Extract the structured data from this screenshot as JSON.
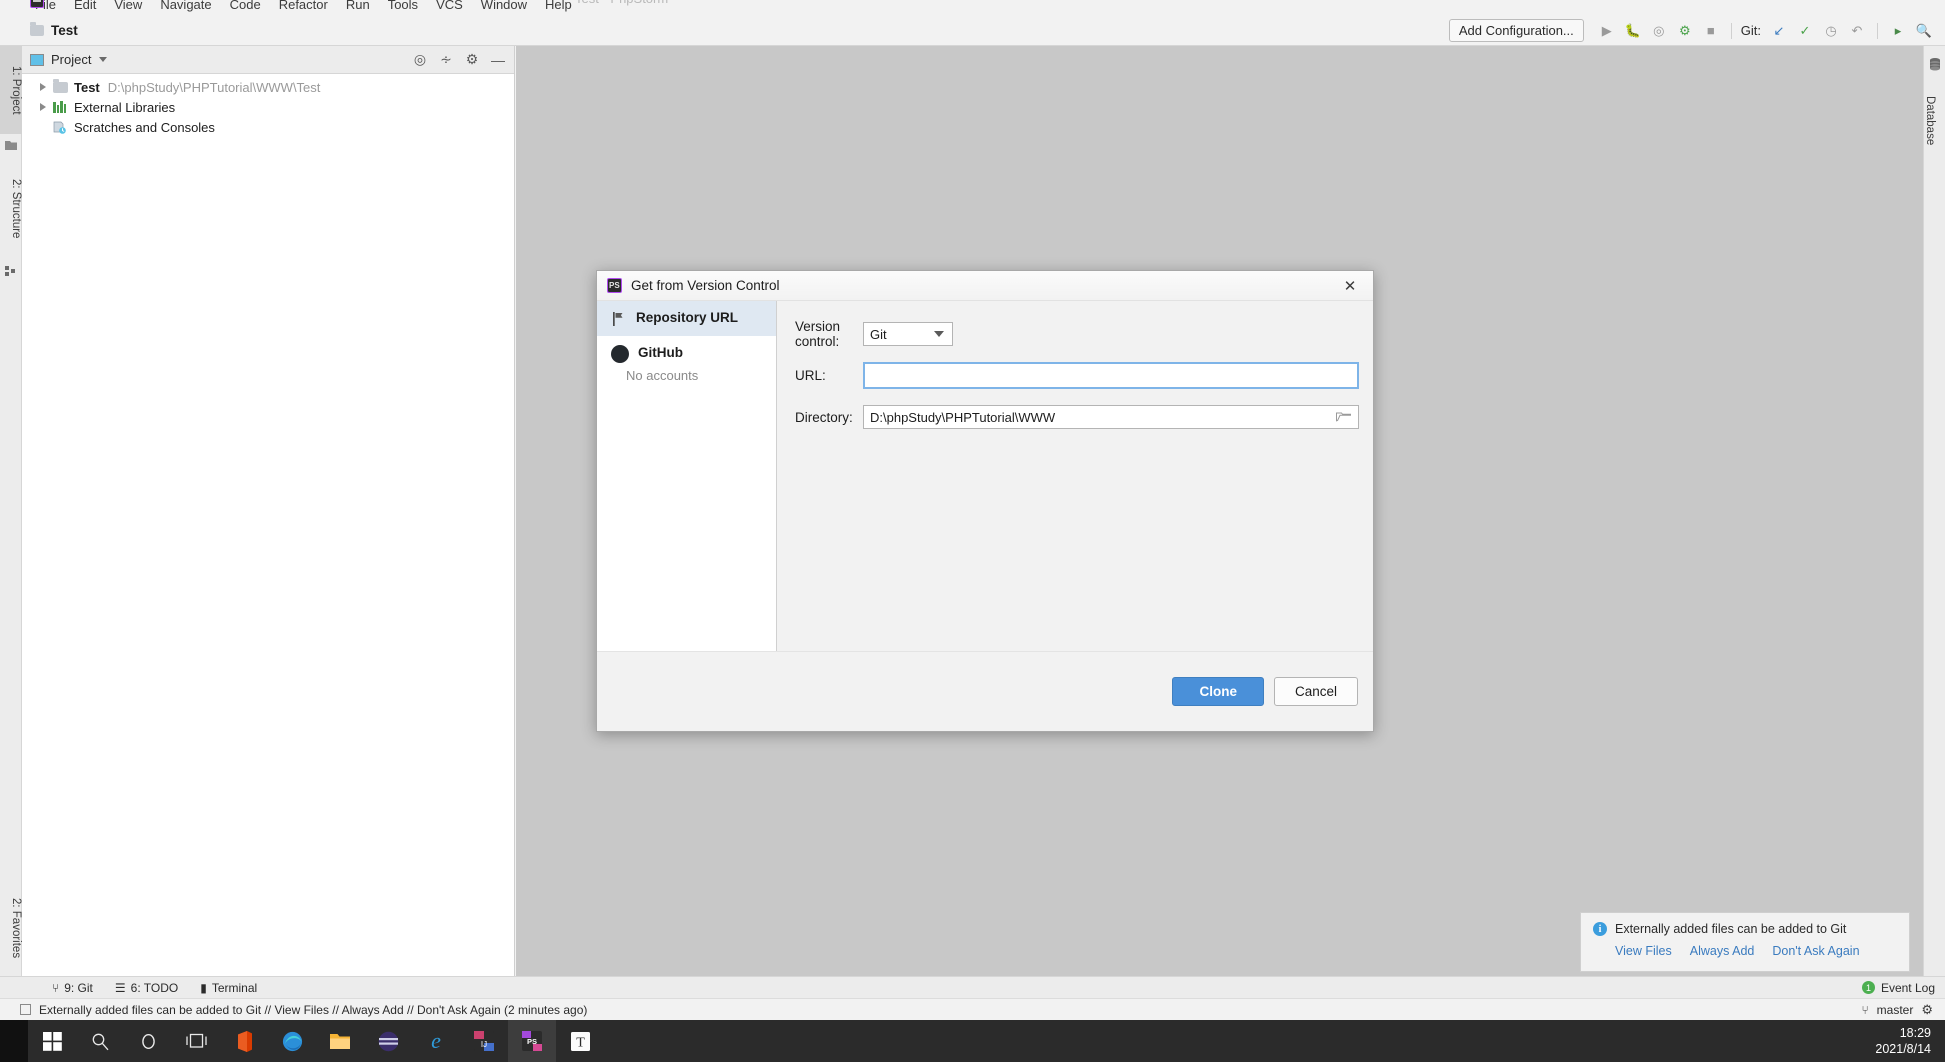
{
  "window": {
    "title": "Test - PhpStorm",
    "menu": [
      "File",
      "Edit",
      "View",
      "Navigate",
      "Code",
      "Refactor",
      "Run",
      "Tools",
      "VCS",
      "Window",
      "Help"
    ],
    "controls": [
      "minimize-icon",
      "maximize-icon",
      "close-icon"
    ]
  },
  "toolbar": {
    "breadcrumb": "Test",
    "add_configuration": "Add Configuration...",
    "git_label": "Git:",
    "icons": [
      "run-icon",
      "debug-icon",
      "run-coverage-icon",
      "profile-icon",
      "stop-icon",
      "update-project-icon",
      "commit-icon",
      "history-icon",
      "rollback-icon",
      "search-everywhere-icon",
      "find-icon"
    ]
  },
  "left_strip": {
    "tabs": [
      {
        "label": "1: Project",
        "icon": "project-icon",
        "selected": true
      },
      {
        "label": "2: Structure",
        "icon": "structure-icon",
        "selected": false
      },
      {
        "label": "2: Favorites",
        "icon": "star-icon",
        "selected": false
      }
    ]
  },
  "right_strip": {
    "tabs": [
      {
        "label": "Database",
        "icon": "database-icon"
      }
    ]
  },
  "project_panel": {
    "title": "Project",
    "actions": [
      "locate-icon",
      "collapse-all-icon",
      "settings-gear-icon",
      "hide-icon"
    ],
    "tree": [
      {
        "label": "Test",
        "path": "D:\\phpStudy\\PHPTutorial\\WWW\\Test",
        "icon": "folder-icon",
        "expandable": true,
        "bold": true
      },
      {
        "label": "External Libraries",
        "path": "",
        "icon": "library-icon",
        "expandable": true,
        "bold": false
      },
      {
        "label": "Scratches and Consoles",
        "path": "",
        "icon": "scratches-icon",
        "expandable": false,
        "bold": false
      }
    ]
  },
  "dialog": {
    "title": "Get from Version Control",
    "icon": "phpstorm-icon",
    "close_icon": "close-icon",
    "sidebar": [
      {
        "label": "Repository URL",
        "sub": "",
        "icon": "repository-url-icon",
        "active": true
      },
      {
        "label": "GitHub",
        "sub": "No accounts",
        "icon": "github-icon",
        "active": false
      }
    ],
    "fields": {
      "version_control_label": "Version control:",
      "version_control_value": "Git",
      "version_control_options": [
        "Git"
      ],
      "url_label": "URL:",
      "url_value": "",
      "url_placeholder": "",
      "directory_label": "Directory:",
      "directory_value": "D:\\phpStudy\\PHPTutorial\\WWW",
      "browse_icon": "folder-open-icon"
    },
    "buttons": {
      "primary": "Clone",
      "secondary": "Cancel"
    }
  },
  "balloon": {
    "icon": "info-icon",
    "message": "Externally added files can be added to Git",
    "links": [
      "View Files",
      "Always Add",
      "Don't Ask Again"
    ]
  },
  "tool_window_bar": {
    "items": [
      {
        "label": "9: Git",
        "icon": "git-branch-icon"
      },
      {
        "label": "6: TODO",
        "icon": "todo-list-icon"
      },
      {
        "label": "Terminal",
        "icon": "terminal-icon"
      }
    ],
    "event_log_label": "Event Log",
    "event_log_count": "1"
  },
  "status_bar": {
    "message": "Externally added files can be added to Git // View Files // Always Add // Don't Ask Again (2 minutes ago)",
    "branch": "master",
    "branch_icon": "git-branch-icon",
    "sync_icon": "sync-icon"
  },
  "taskbar": {
    "items": [
      {
        "name": "start-button",
        "glyph": "⊞",
        "color": "#ffffff",
        "active": false
      },
      {
        "name": "search-icon",
        "glyph": "⚲",
        "color": "#e8e8e8",
        "active": false
      },
      {
        "name": "cortana-icon",
        "glyph": "◯",
        "color": "#e8e8e8",
        "active": false
      },
      {
        "name": "task-view-icon",
        "glyph": "⌸",
        "color": "#e8e8e8",
        "active": false
      },
      {
        "name": "office-icon",
        "glyph": "▮",
        "color": "#d83b01",
        "active": false
      },
      {
        "name": "edge-icon",
        "glyph": "◔",
        "color": "#2fa0d8",
        "active": false
      },
      {
        "name": "file-explorer-icon",
        "glyph": "▤",
        "color": "#f5b335",
        "active": false
      },
      {
        "name": "app-purple-icon",
        "glyph": "⬤",
        "color": "#4b3b82",
        "active": false
      },
      {
        "name": "internet-explorer-icon",
        "glyph": "e",
        "color": "#2f9ad8",
        "active": false
      },
      {
        "name": "intellij-idea-icon",
        "glyph": "IJ",
        "color": "#e8457a",
        "active": false
      },
      {
        "name": "phpstorm-icon",
        "glyph": "PS",
        "color": "#b14cf0",
        "active": true
      },
      {
        "name": "typora-icon",
        "glyph": "T",
        "color": "#2b2b2b",
        "active": false
      }
    ],
    "clock": {
      "time": "18:29",
      "date": "2021/8/14"
    }
  }
}
